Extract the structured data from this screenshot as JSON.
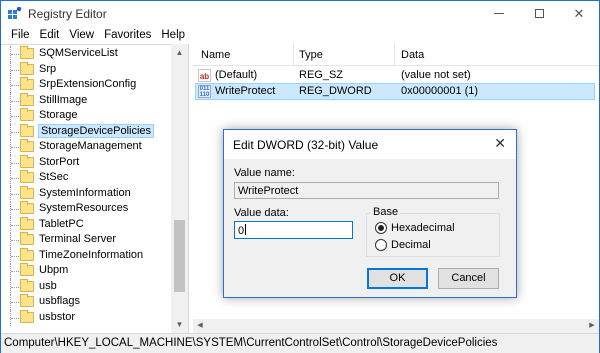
{
  "window": {
    "title": "Registry Editor",
    "accent_color": "#1e6fcf",
    "controls": {
      "minimize_icon": "minimize-icon",
      "maximize_icon": "maximize-icon",
      "close_icon": "close-icon",
      "close_glyph": "✕"
    }
  },
  "menu": {
    "items": [
      "File",
      "Edit",
      "View",
      "Favorites",
      "Help"
    ]
  },
  "tree": {
    "items": [
      {
        "label": "SQMServiceList",
        "selected": false
      },
      {
        "label": "Srp",
        "selected": false
      },
      {
        "label": "SrpExtensionConfig",
        "selected": false
      },
      {
        "label": "StillImage",
        "selected": false
      },
      {
        "label": "Storage",
        "selected": false
      },
      {
        "label": "StorageDevicePolicies",
        "selected": true
      },
      {
        "label": "StorageManagement",
        "selected": false
      },
      {
        "label": "StorPort",
        "selected": false
      },
      {
        "label": "StSec",
        "selected": false
      },
      {
        "label": "SystemInformation",
        "selected": false
      },
      {
        "label": "SystemResources",
        "selected": false
      },
      {
        "label": "TabletPC",
        "selected": false
      },
      {
        "label": "Terminal Server",
        "selected": false
      },
      {
        "label": "TimeZoneInformation",
        "selected": false
      },
      {
        "label": "Ubpm",
        "selected": false
      },
      {
        "label": "usb",
        "selected": false
      },
      {
        "label": "usbflags",
        "selected": false
      },
      {
        "label": "usbstor",
        "selected": false
      }
    ]
  },
  "list": {
    "columns": [
      "Name",
      "Type",
      "Data"
    ],
    "rows": [
      {
        "name": "(Default)",
        "type": "REG_SZ",
        "data": "(value not set)",
        "icon": "ab-string-icon",
        "icon_glyph": "ab",
        "selected": false
      },
      {
        "name": "WriteProtect",
        "type": "REG_DWORD",
        "data": "0x00000001 (1)",
        "icon": "binary-value-icon",
        "icon_glyph": "011 110",
        "selected": true
      }
    ]
  },
  "statusbar": {
    "path": "Computer\\HKEY_LOCAL_MACHINE\\SYSTEM\\CurrentControlSet\\Control\\StorageDevicePolicies"
  },
  "dialog": {
    "title": "Edit DWORD (32-bit) Value",
    "close_glyph": "✕",
    "value_name_label": "Value name:",
    "value_name": "WriteProtect",
    "value_data_label": "Value data:",
    "value_data": "0",
    "base_label": "Base",
    "base_options": [
      {
        "label": "Hexadecimal",
        "checked": true
      },
      {
        "label": "Decimal",
        "checked": false
      }
    ],
    "ok_label": "OK",
    "cancel_label": "Cancel"
  }
}
